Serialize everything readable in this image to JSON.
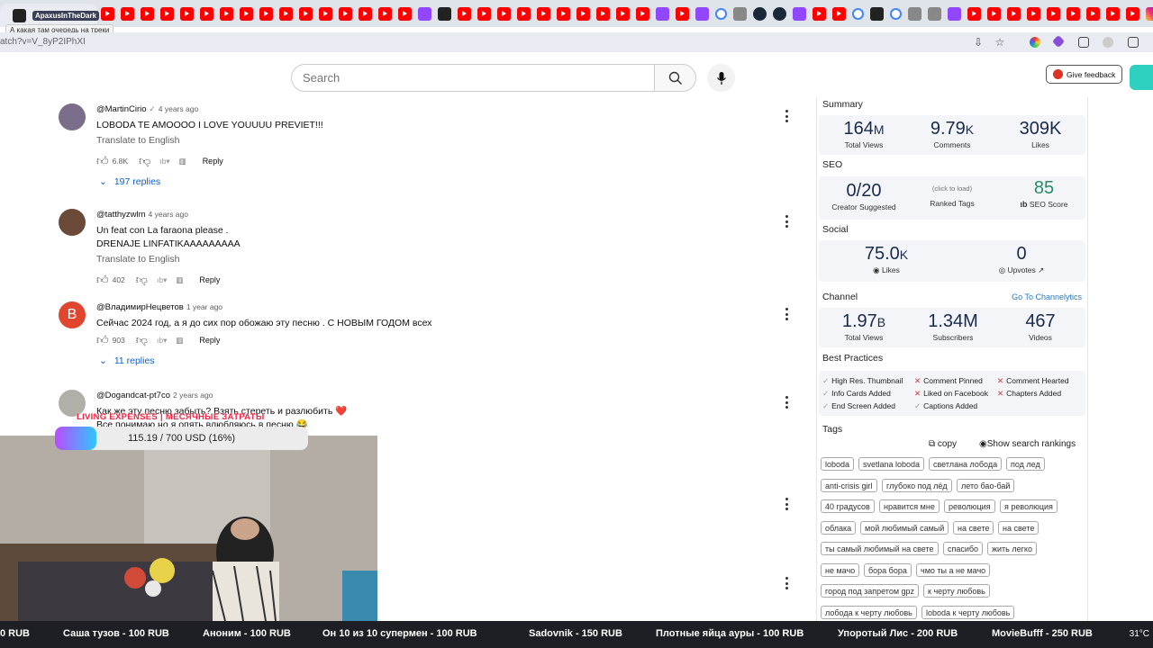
{
  "browser": {
    "active_tab_label": "ApaxusInTheDark",
    "tab_tooltip": "А какая там очередь на треки",
    "url_fragment": "atch?v=V_8yP2IPhXI",
    "tab_favicons": [
      "yt",
      "yt",
      "yt",
      "yt",
      "yt",
      "yt",
      "yt",
      "yt",
      "yt",
      "yt",
      "yt",
      "yt",
      "yt",
      "yt",
      "yt",
      "yt",
      "tw",
      "dark",
      "yt",
      "yt",
      "yt",
      "yt",
      "yt",
      "yt",
      "yt",
      "yt",
      "yt",
      "yt",
      "tw",
      "yt",
      "tw",
      "g",
      "gray",
      "steam",
      "steam",
      "tw",
      "yt",
      "yt",
      "g",
      "dark",
      "g",
      "gray",
      "gray",
      "tw",
      "yt",
      "yt",
      "yt",
      "yt",
      "yt",
      "yt",
      "yt",
      "yt",
      "yt",
      "ig",
      "k"
    ]
  },
  "search": {
    "placeholder": "Search"
  },
  "feedback": {
    "label": "Give feedback"
  },
  "comments": [
    {
      "author": "@MartinCirio",
      "verified": true,
      "time": "4 years ago",
      "lines": [
        "LOBODA TE AMOOOO I LOVE YOUUUU PREVIET!!!"
      ],
      "translate": "Translate to English",
      "likes": "6.8K",
      "reply": "Reply",
      "replies": "197 replies",
      "avatar_color": "#7a6e8a"
    },
    {
      "author": "@tatthyzwlm",
      "verified": false,
      "time": "4 years ago",
      "lines": [
        "Un feat con La faraona please .",
        "DRENAJE LINFATIKAAAAAAAAA"
      ],
      "translate": "Translate to English",
      "likes": "402",
      "reply": "Reply",
      "replies": "",
      "avatar_color": "#6b4a3a"
    },
    {
      "author": "@ВладимирНецветов",
      "verified": false,
      "time": "1 year ago",
      "lines": [
        "Сейчас 2024 год, а я до сих пор обожаю эту песню . С НОВЫМ ГОДОМ всех"
      ],
      "translate": "",
      "likes": "903",
      "reply": "Reply",
      "replies": "11 replies",
      "avatar_letter": "В",
      "avatar_color": "#e0452e"
    },
    {
      "author": "@Dogandcat-pt7co",
      "verified": false,
      "time": "2 years ago",
      "lines": [
        "Как же эту песню забыть? Взять стереть и разлюбить ❤️",
        "Все понимаю но я опять влюбляюсь в песню 😂"
      ],
      "translate": "",
      "likes": "",
      "reply": "",
      "replies": "",
      "avatar_color": "#b0b0a8"
    }
  ],
  "panel": {
    "summary": {
      "title": "Summary",
      "stats": [
        {
          "value": "164",
          "suffix": "M",
          "label": "Total Views"
        },
        {
          "value": "9.79",
          "suffix": "K",
          "label": "Comments"
        },
        {
          "value": "309K",
          "suffix": "",
          "label": "Likes"
        }
      ]
    },
    "seo": {
      "title": "SEO",
      "creator_value": "0/20",
      "creator_label": "Creator Suggested",
      "tags_hint": "(click to load)",
      "tags_label": "Ranked Tags",
      "score_value": "85",
      "score_label": "SEO Score",
      "score_color": "#2a8a6a"
    },
    "social": {
      "title": "Social",
      "likes_value": "75.0",
      "likes_suffix": "K",
      "likes_label": "Likes",
      "upvotes_value": "0",
      "upvotes_label": "Upvotes"
    },
    "channel": {
      "title": "Channel",
      "link": "Go To Channelytics",
      "stats": [
        {
          "value": "1.97",
          "suffix": "B",
          "label": "Total Views"
        },
        {
          "value": "1.34M",
          "suffix": "",
          "label": "Subscribers"
        },
        {
          "value": "467",
          "suffix": "",
          "label": "Videos"
        }
      ]
    },
    "best_practices": {
      "title": "Best Practices",
      "items": [
        {
          "label": "High Res. Thumbnail",
          "ok": true
        },
        {
          "label": "Comment Pinned",
          "ok": false
        },
        {
          "label": "Comment Hearted",
          "ok": false
        },
        {
          "label": "Info Cards Added",
          "ok": true
        },
        {
          "label": "Liked on Facebook",
          "ok": false
        },
        {
          "label": "Chapters Added",
          "ok": false
        },
        {
          "label": "End Screen Added",
          "ok": true
        },
        {
          "label": "Captions Added",
          "ok": true
        }
      ]
    },
    "tags": {
      "title": "Tags",
      "copy": "copy",
      "show": "Show search rankings",
      "rows": [
        [
          "loboda",
          "svetlana loboda",
          "светлана лобода",
          "под лед"
        ],
        [
          "anti-crisis girl",
          "глубоко под лёд",
          "лето бао-бай"
        ],
        [
          "40 градусов",
          "нравится мне",
          "революция",
          "я революция"
        ],
        [
          "облака",
          "мой любимый самый",
          "на свете",
          "на свете"
        ],
        [
          "ты самый любимый на свете",
          "спасибо",
          "жить легко"
        ],
        [
          "не мачо",
          "бора бора",
          "чмо ты а не мачо"
        ],
        [
          "город под запретом gpz",
          "к черту любовь"
        ],
        [
          "лобода к черту любовь",
          "loboda к черту любовь"
        ]
      ]
    }
  },
  "overlay": {
    "expenses_title": "LIVING EXPENSES | МЕСЯЧНЫЕ ЗАТРАТЫ",
    "progress_text": "115.19 / 700 USD (16%)",
    "progress_fraction": 0.1646
  },
  "ticker": {
    "items": [
      "0 RUB",
      "Саша тузов - 100 RUB",
      "Аноним - 100 RUB",
      "Он 10 из 10 супермен - 100 RUB",
      "Sadovnik - 150 RUB",
      "Плотные яйца ауры - 100 RUB",
      "Упоротый Лис - 200 RUB",
      "MovieBufff - 250 RUB"
    ],
    "weather": "31°C"
  }
}
